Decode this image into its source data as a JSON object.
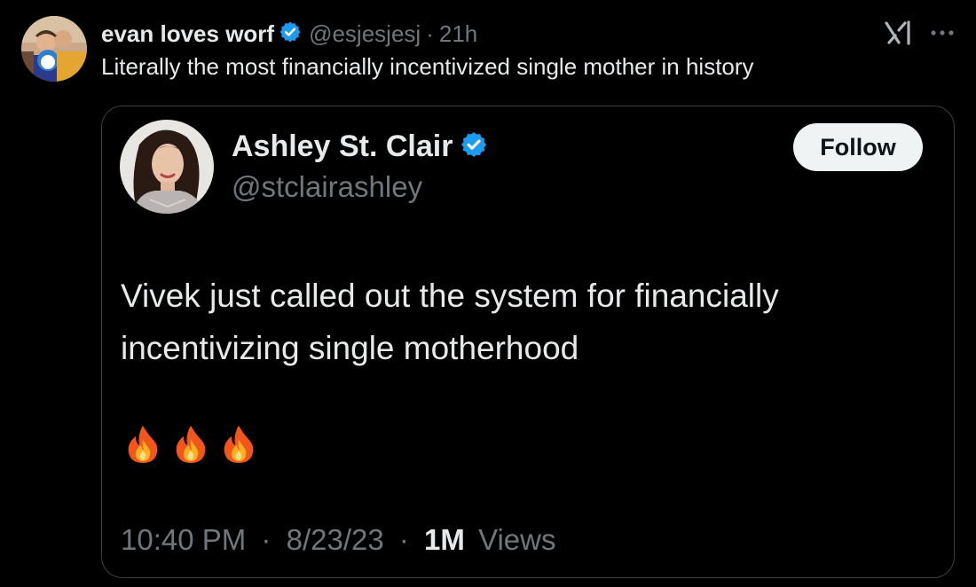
{
  "outer_tweet": {
    "author_name": "evan loves worf",
    "handle": "@esjesjesj",
    "separator": "·",
    "time": "21h",
    "text": "Literally the most financially incentivized single mother in history"
  },
  "quoted_tweet": {
    "author_name": "Ashley St. Clair",
    "handle": "@stclairashley",
    "follow_label": "Follow",
    "text": "Vivek just called out the system for financially incentivizing single motherhood",
    "emojis": [
      "🔥",
      "🔥",
      "🔥"
    ],
    "time": "10:40 PM",
    "separator": "·",
    "date": "8/23/23",
    "views_count": "1M",
    "views_label": "Views"
  },
  "icons": {
    "verified": "verified-badge-icon",
    "xai": "xai-logo-icon",
    "more": "more-options-icon",
    "fire": "fire-emoji-icon"
  },
  "colors": {
    "background": "#000000",
    "primary_text": "#e7e9ea",
    "secondary_text": "#71767b",
    "verified_blue": "#1d9bf0",
    "card_border": "#3b3f43",
    "follow_bg": "#eff3f4"
  }
}
